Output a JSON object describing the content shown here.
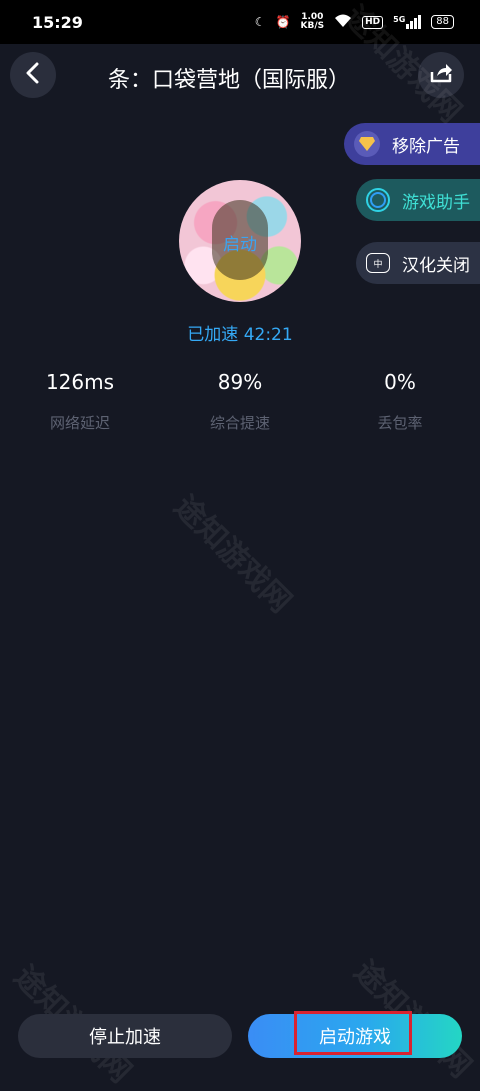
{
  "status_bar": {
    "time": "15:29",
    "speed_value": "1.00",
    "speed_unit": "KB/S",
    "hd": "HD",
    "network": "5G",
    "battery": "88"
  },
  "header": {
    "title": "条：口袋营地（国际服）"
  },
  "side_menu": [
    {
      "label": "移除广告",
      "icon": "diamond-icon",
      "color": "#3e3f9c"
    },
    {
      "label": "游戏助手",
      "icon": "assistant-ring-icon",
      "color": "#1d5a5e"
    },
    {
      "label": "汉化关闭",
      "icon": "translate-icon",
      "color": "#2c3244"
    }
  ],
  "game": {
    "avatar_label": "启动",
    "accel_status": "已加速 42:21"
  },
  "stats": [
    {
      "value": "126ms",
      "label": "网络延迟"
    },
    {
      "value": "89%",
      "label": "综合提速"
    },
    {
      "value": "0%",
      "label": "丢包率"
    }
  ],
  "buttons": {
    "stop": "停止加速",
    "launch": "启动游戏"
  },
  "watermark": "途知游戏网",
  "colors": {
    "background": "#151823",
    "accent_blue": "#35a9f5",
    "highlight_red": "#d92330"
  }
}
